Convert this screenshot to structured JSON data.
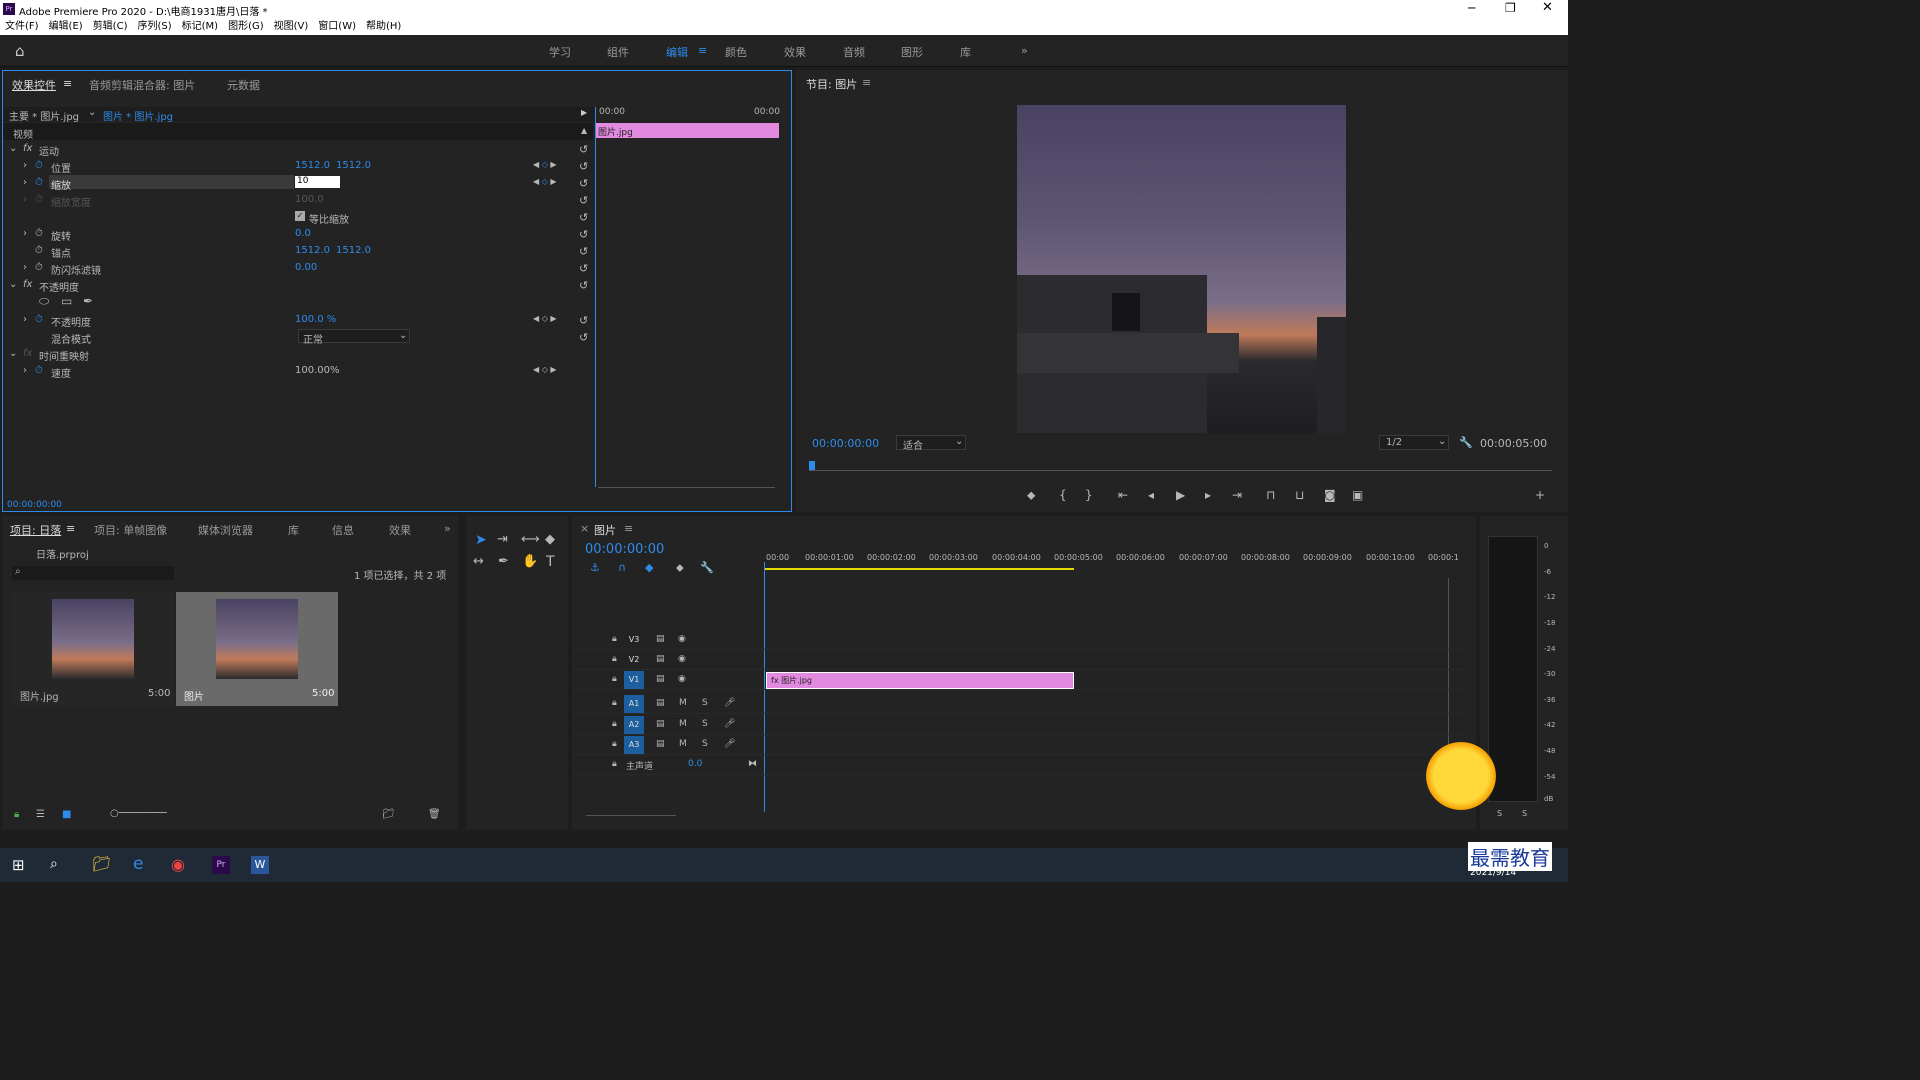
{
  "title": "Adobe Premiere Pro 2020 - D:\\电商1931唐月\\日落 *",
  "menu": [
    "文件(F)",
    "编辑(E)",
    "剪辑(C)",
    "序列(S)",
    "标记(M)",
    "图形(G)",
    "视图(V)",
    "窗口(W)",
    "帮助(H)"
  ],
  "workspaces": [
    "学习",
    "组件",
    "编辑",
    "颜色",
    "效果",
    "音频",
    "图形",
    "库"
  ],
  "effects": {
    "tabs": [
      "效果控件",
      "音频剪辑混合器: 图片",
      "元数据"
    ],
    "master": "主要 * 图片.jpg",
    "clip": "图片 * 图片.jpg",
    "video": "视频",
    "motion": "运动",
    "position": "位置",
    "pos_x": "1512.0",
    "pos_y": "1512.0",
    "scale": "缩放",
    "scale_value": "10",
    "scale_width": "缩放宽度",
    "scale_width_value": "100.0",
    "uniform": "等比缩放",
    "rotation": "旋转",
    "rotation_value": "0.0",
    "anchor": "锚点",
    "anchor_x": "1512.0",
    "anchor_y": "1512.0",
    "flicker": "防闪烁滤镜",
    "flicker_value": "0.00",
    "opacity_group": "不透明度",
    "opacity": "不透明度",
    "opacity_value": "100.0 %",
    "blend": "混合模式",
    "blend_value": "正常",
    "remap": "时间重映射",
    "speed": "速度",
    "speed_value": "100.00%",
    "tl_start": "00:00",
    "tl_end": "00:00",
    "clip_bar": "图片.jpg",
    "timecode": "00:00:00:00"
  },
  "program": {
    "title": "节目: 图片",
    "timecode": "00:00:00:00",
    "fit": "适合",
    "res": "1/2",
    "duration": "00:00:05:00"
  },
  "project": {
    "tabs": [
      "项目: 日落",
      "项目: 单帧图像",
      "媒体浏览器",
      "库",
      "信息",
      "效果"
    ],
    "file": "日落.prproj",
    "selection": "1 项已选择，共 2 项",
    "items": [
      {
        "name": "图片.jpg",
        "dur": "5:00"
      },
      {
        "name": "图片",
        "dur": "5:00"
      }
    ]
  },
  "timeline": {
    "tab": "图片",
    "timecode": "00:00:00:00",
    "ruler": [
      "00:00",
      "00:00:01:00",
      "00:00:02:00",
      "00:00:03:00",
      "00:00:04:00",
      "00:00:05:00",
      "00:00:06:00",
      "00:00:07:00",
      "00:00:08:00",
      "00:00:09:00",
      "00:00:10:00",
      "00:00:1"
    ],
    "tracks": [
      "V3",
      "V2",
      "V1",
      "A1",
      "A2",
      "A3"
    ],
    "master": "主声道",
    "master_val": "0.0",
    "clip": "图片.jpg"
  },
  "meter": [
    "0",
    "-6",
    "-12",
    "-18",
    "-24",
    "-30",
    "-36",
    "-42",
    "-48",
    "-54",
    "dB"
  ],
  "taskbar": {
    "date": "2021/9/14",
    "brand": "最需教育"
  }
}
